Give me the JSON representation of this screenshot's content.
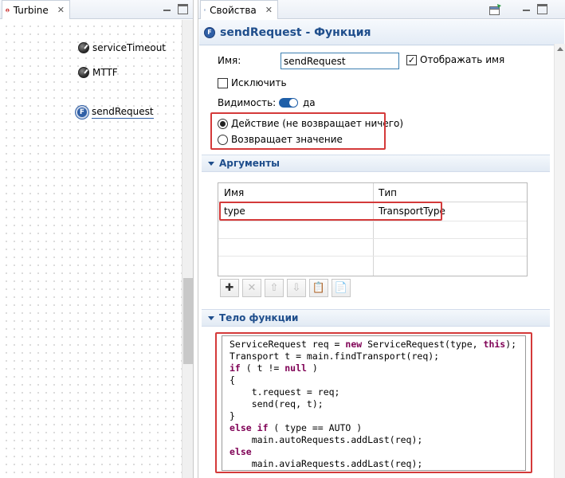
{
  "left_panel": {
    "tab_title": "Turbine",
    "tab_close": "✕",
    "elements": [
      {
        "label": "serviceTimeout",
        "kind": "parameter"
      },
      {
        "label": "MTTF",
        "kind": "parameter"
      },
      {
        "label": "sendRequest",
        "kind": "function",
        "icon_letter": "F"
      }
    ]
  },
  "right_panel": {
    "tab_title": "Свойства",
    "tab_close": "✕",
    "title": "sendRequest - Функция",
    "title_icon_letter": "F",
    "name_label": "Имя:",
    "name_value": "sendRequest",
    "show_name_label": "Отображать имя",
    "show_name_checked": true,
    "exclude_label": "Исключить",
    "exclude_checked": false,
    "visibility_label": "Видимость:",
    "visibility_value": "да",
    "radio_action": "Действие (не возвращает ничего)",
    "radio_return": "Возвращает значение",
    "radio_selected": "action",
    "arguments_section": "Аргументы",
    "arguments_table": {
      "headers": [
        "Имя",
        "Тип"
      ],
      "rows": [
        [
          "type",
          "TransportType"
        ]
      ]
    },
    "toolbar": {
      "add": "✚",
      "remove": "✕",
      "up": "⇧",
      "down": "⇩",
      "paste": "📋",
      "copy": "📄"
    },
    "body_section": "Тело функции",
    "code_lines": [
      [
        {
          "t": "ServiceRequest req = "
        },
        {
          "t": "new",
          "k": 1
        },
        {
          "t": " ServiceRequest(type, "
        },
        {
          "t": "this",
          "k": 1
        },
        {
          "t": ");"
        }
      ],
      [
        {
          "t": "Transport t = main.findTransport(req);"
        }
      ],
      [
        {
          "t": "if",
          "k": 1
        },
        {
          "t": " ( t != "
        },
        {
          "t": "null",
          "k": 1
        },
        {
          "t": " )"
        }
      ],
      [
        {
          "t": "{"
        }
      ],
      [
        {
          "t": "    t.request = req;"
        }
      ],
      [
        {
          "t": "    send(req, t);"
        }
      ],
      [
        {
          "t": "}"
        }
      ],
      [
        {
          "t": "else",
          "k": 1
        },
        {
          "t": " "
        },
        {
          "t": "if",
          "k": 1
        },
        {
          "t": " ( type == AUTO )"
        }
      ],
      [
        {
          "t": "    main.autoRequests.addLast(req);"
        }
      ],
      [
        {
          "t": "else",
          "k": 1
        }
      ],
      [
        {
          "t": "    main.aviaRequests.addLast(req);"
        }
      ]
    ]
  }
}
